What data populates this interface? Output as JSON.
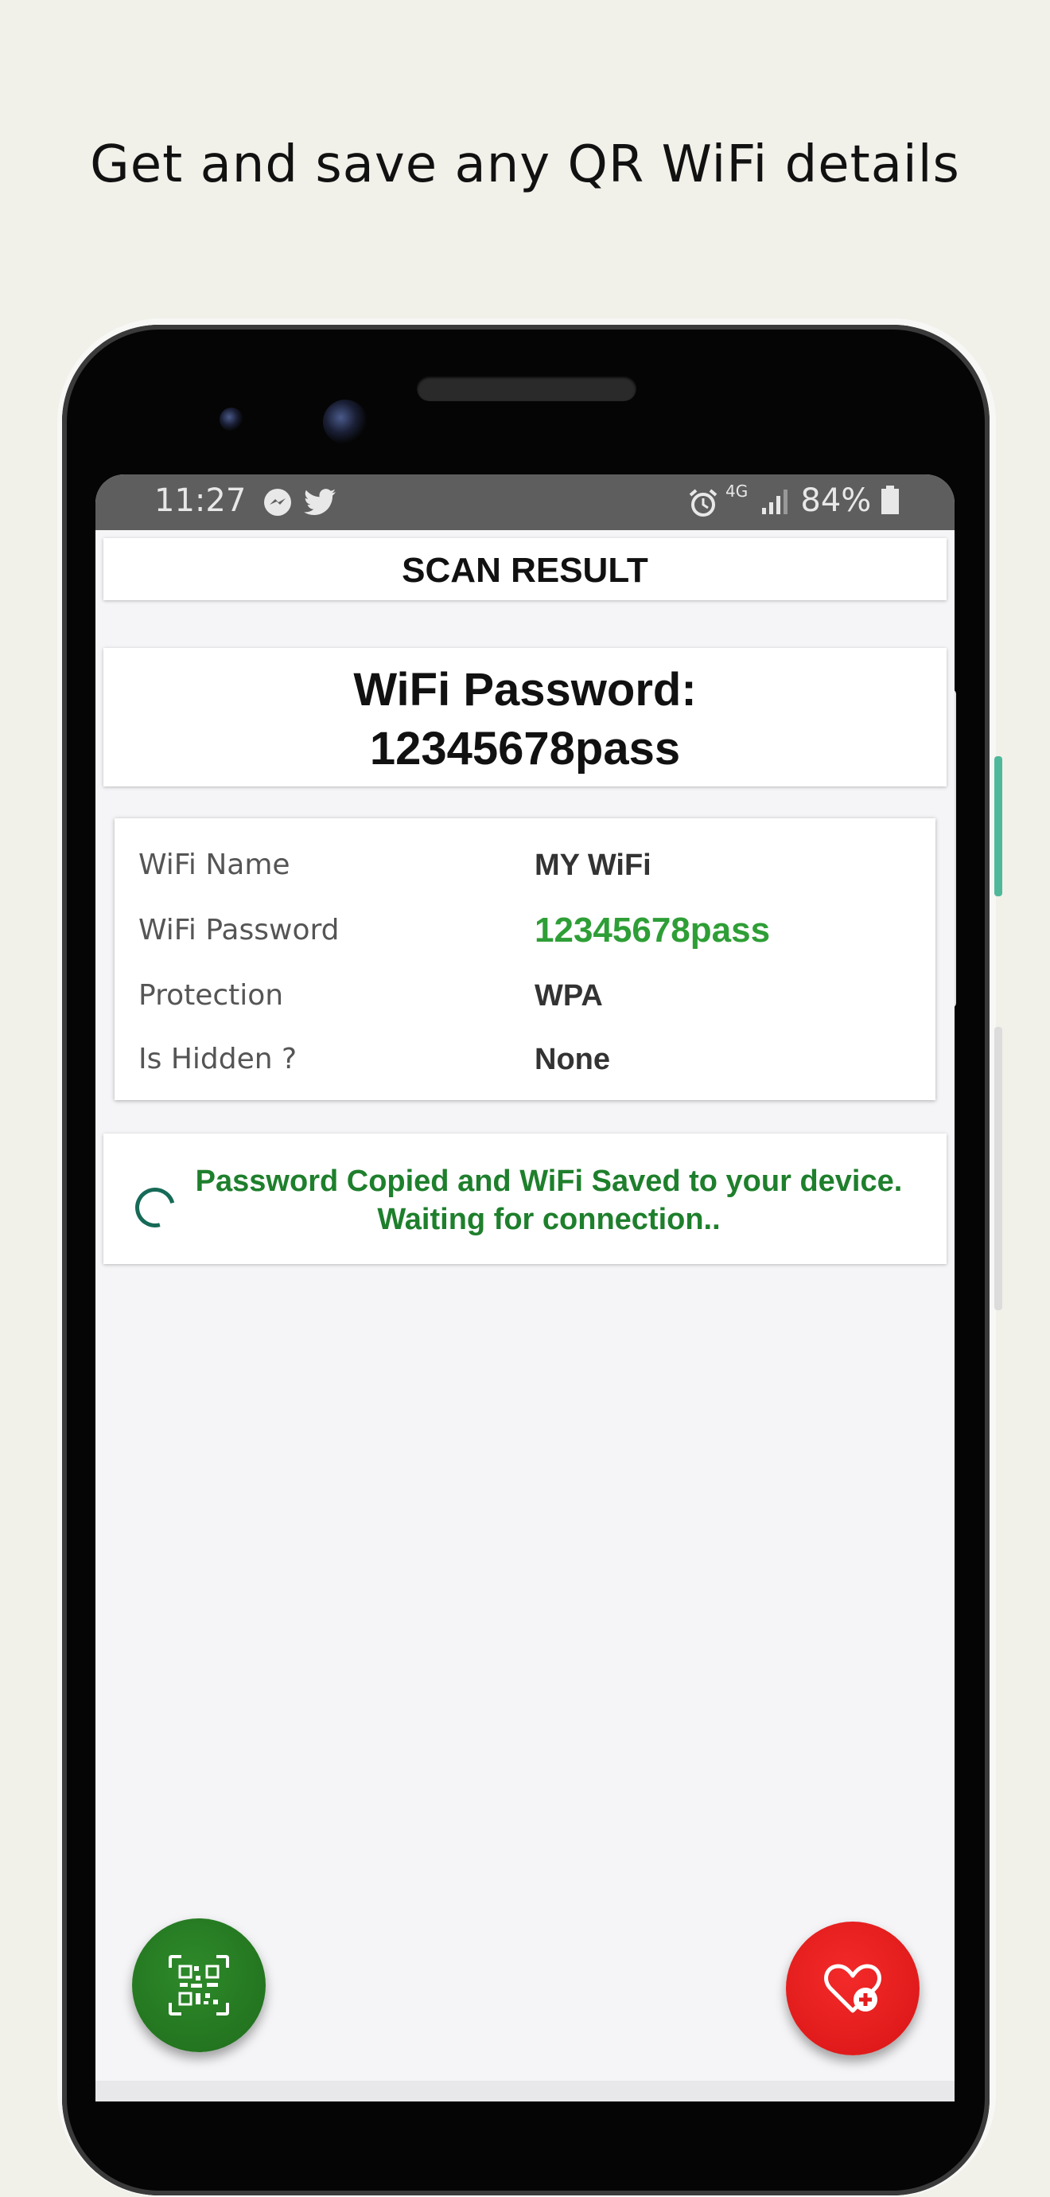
{
  "headline": "Get and save any QR WiFi details",
  "statusbar": {
    "time": "11:27",
    "battery": "84%",
    "network": "4G",
    "icons": [
      "messenger-icon",
      "twitter-icon",
      "alarm-icon",
      "signal-icon",
      "battery-icon"
    ]
  },
  "screen": {
    "title": "SCAN RESULT",
    "password_heading_line1": "WiFi Password:",
    "password_heading_line2": "12345678pass",
    "details": [
      {
        "label": "WiFi Name",
        "value": "MY WiFi"
      },
      {
        "label": "WiFi Password",
        "value": "12345678pass"
      },
      {
        "label": "Protection",
        "value": "WPA"
      },
      {
        "label": "Is Hidden ?",
        "value": "None"
      }
    ],
    "status_line1": "Password Copied and WiFi Saved to your device.",
    "status_line2": "Waiting for connection.."
  },
  "fabs": {
    "scan_icon": "qr-scan-icon",
    "favorite_icon": "heart-plus-icon"
  },
  "colors": {
    "background": "#f1f0e9",
    "password_green": "#2e9e36",
    "status_green": "#1e7f2c",
    "scan_button": "#23781f",
    "favorite_button": "#e41c1c"
  }
}
